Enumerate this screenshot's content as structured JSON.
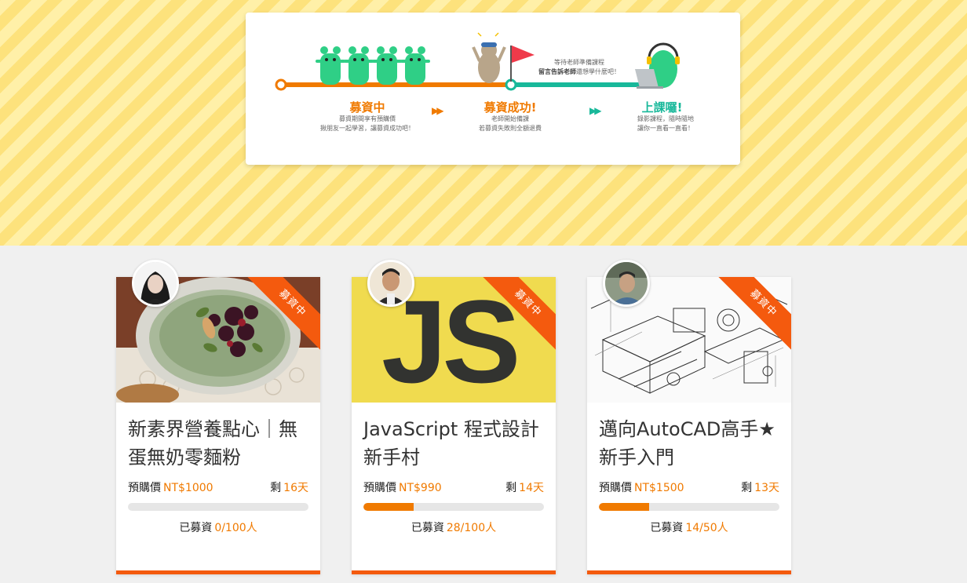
{
  "process": {
    "stages": [
      {
        "title": "募資中",
        "desc_line1": "募資期間享有預購價",
        "desc_line2": "揪朋友一起學習，讓募資成功吧！"
      },
      {
        "title": "募資成功!",
        "desc_line1": "老師開始備課",
        "desc_line2": "若募資失敗則全額退費"
      },
      {
        "title": "上課囉!",
        "desc_line1": "錄影課程，隨時隨地",
        "desc_line2": "讓你一直看一直看！"
      }
    ],
    "bubble_line1": "等待老師準備課程",
    "bubble_line2_bold": "留言告訴老師",
    "bubble_line2_rest": "還想學什麼吧！",
    "arrow_glyph": "▶▶",
    "colors": {
      "orange": "#f07a00",
      "green": "#18b89a"
    }
  },
  "courses": [
    {
      "title": "新素界營養點心｜無蛋無奶零麵粉",
      "badge": "募資中",
      "price_label": "預購價",
      "price": "NT$1000",
      "days_label": "剩",
      "days": "16天",
      "funded_label": "已募資",
      "funded": "0/100人",
      "progress": 0.0
    },
    {
      "title": "JavaScript 程式設計新手村",
      "badge": "募資中",
      "price_label": "預購價",
      "price": "NT$990",
      "days_label": "剩",
      "days": "14天",
      "funded_label": "已募資",
      "funded": "28/100人",
      "progress": 0.28,
      "image_text": "JS"
    },
    {
      "title": "邁向AutoCAD高手★新手入門",
      "badge": "募資中",
      "price_label": "預購價",
      "price": "NT$1500",
      "days_label": "剩",
      "days": "13天",
      "funded_label": "已募資",
      "funded": "14/50人",
      "progress": 0.28
    }
  ],
  "colors": {
    "accent": "#f07a00",
    "ribbon": "#f45a0e",
    "hero_stripe_a": "#fde27c",
    "hero_stripe_b": "#fff0a8"
  }
}
